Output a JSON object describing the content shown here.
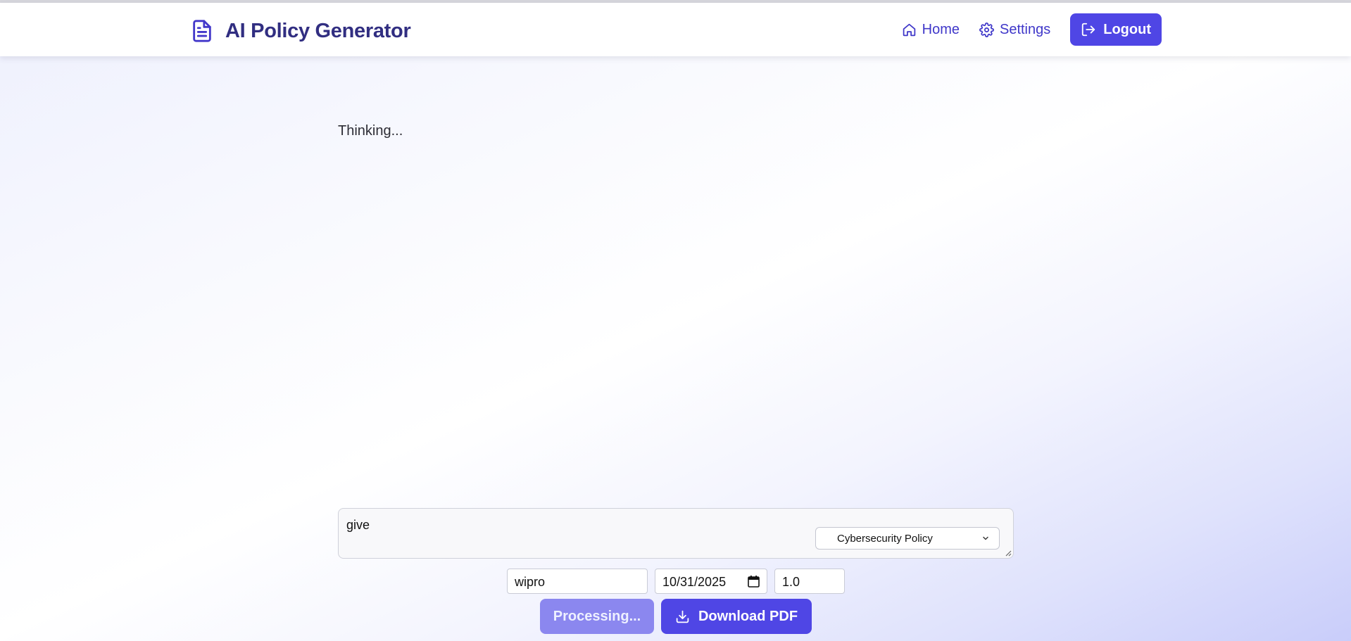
{
  "app": {
    "title": "AI Policy Generator",
    "icon": "document-icon"
  },
  "nav": {
    "home_label": "Home",
    "home_icon": "home-icon",
    "settings_label": "Settings",
    "settings_icon": "gear-icon",
    "logout_label": "Logout",
    "logout_icon": "logout-icon"
  },
  "main": {
    "status_text": "Thinking..."
  },
  "prompt": {
    "value": "give",
    "policy_type": {
      "selected": "Cybersecurity Policy"
    }
  },
  "fields": {
    "company": "wipro",
    "date": "10/31/2025",
    "version": "1.0"
  },
  "actions": {
    "processing_label": "Processing...",
    "download_label": "Download PDF",
    "download_icon": "download-icon"
  },
  "colors": {
    "brand_dark": "#312e81",
    "accent": "#4f46e5",
    "accent_disabled": "#8b87ef",
    "link": "#3f37c9"
  }
}
